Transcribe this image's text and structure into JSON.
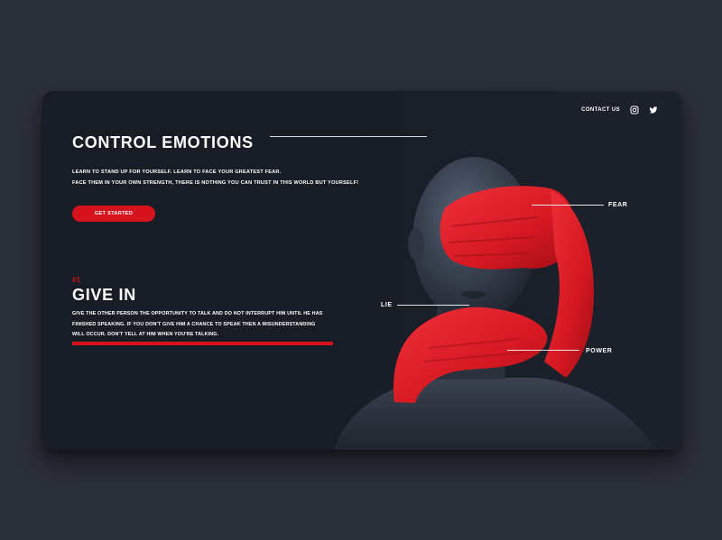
{
  "nav": {
    "contact_label": "CONTACT US",
    "icons": [
      "instagram-icon",
      "twitter-icon"
    ]
  },
  "hero": {
    "title": "CONTROL EMOTIONS",
    "lines": [
      "LEARN TO STAND UP FOR YOURSELF. LEARN TO FACE YOUR GREATEST FEAR.",
      "FACE THEM IN YOUR OWN STRENGTH, THERE IS NOTHING YOU CAN TRUST IN THIS WORLD BUT YOURSELF!"
    ],
    "cta_label": "GET STARTED"
  },
  "section": {
    "number": "#1",
    "title": "GIVE IN",
    "lines": [
      "GIVE THE OTHER PERSON THE OPPORTUNITY TO TALK AND DO NOT INTERRUPT HIM UNTIL HE HAS",
      "FINISHED SPEAKING. IF YOU DON'T GIVE HIM A CHANCE TO SPEAK THEN A MISUNDERSTANDING",
      "WILL OCCUR. DON'T YELL AT HIM WHEN YOU'RE TALKING."
    ]
  },
  "callouts": {
    "fear": "FEAR",
    "lie": "LIE",
    "power": "POWER"
  },
  "colors": {
    "background": "#2b2f3a",
    "card": "#181c24",
    "accent_red": "#d6121f",
    "text": "#ffffff"
  }
}
